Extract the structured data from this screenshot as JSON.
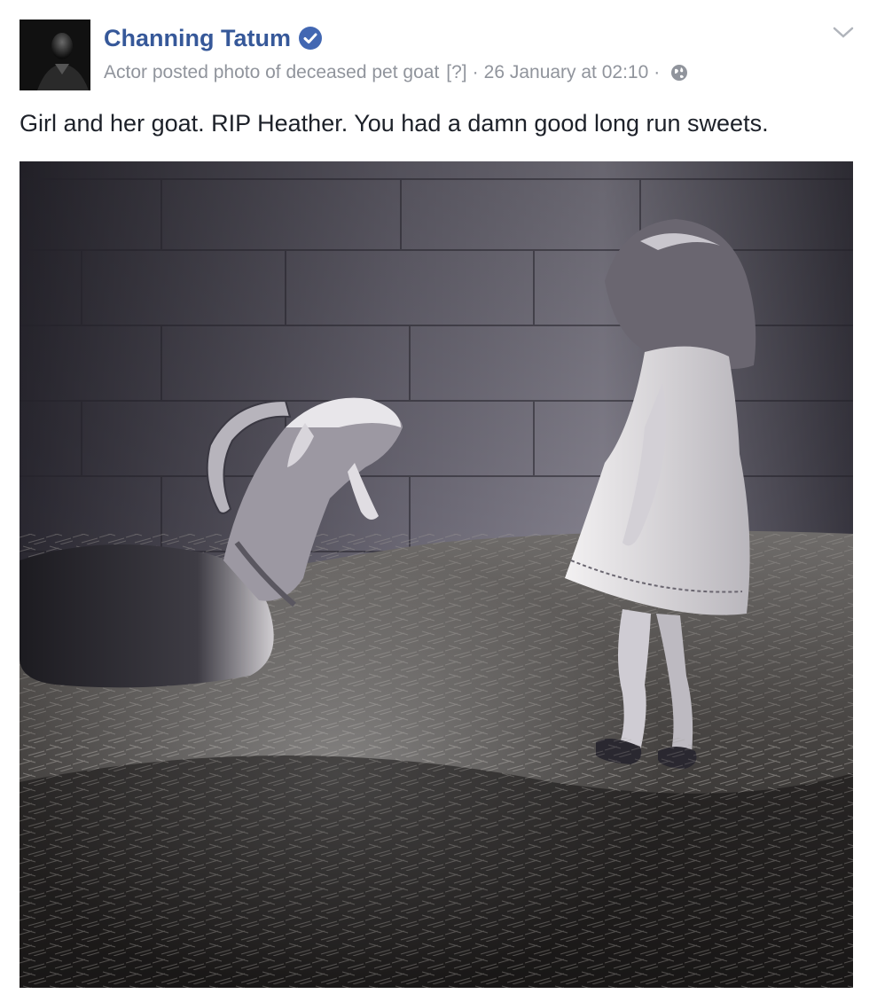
{
  "post": {
    "author": "Channing Tatum",
    "verified": true,
    "subtitle": "Actor posted photo of deceased pet goat",
    "help_link": "[?]",
    "timestamp": "26 January at 02:10",
    "separator": "·",
    "audience_icon": "globe-icon",
    "text": "Girl and her goat. RIP Heather. You had a damn good long run sweets.",
    "photo_alt": "Black and white photo of a little girl in a white dress facing a horned goat lying in hay",
    "menu_icon": "chevron-down-icon"
  },
  "colors": {
    "author": "#365899",
    "meta": "#90949c",
    "text": "#1d2129",
    "verified": "#4267b2"
  }
}
